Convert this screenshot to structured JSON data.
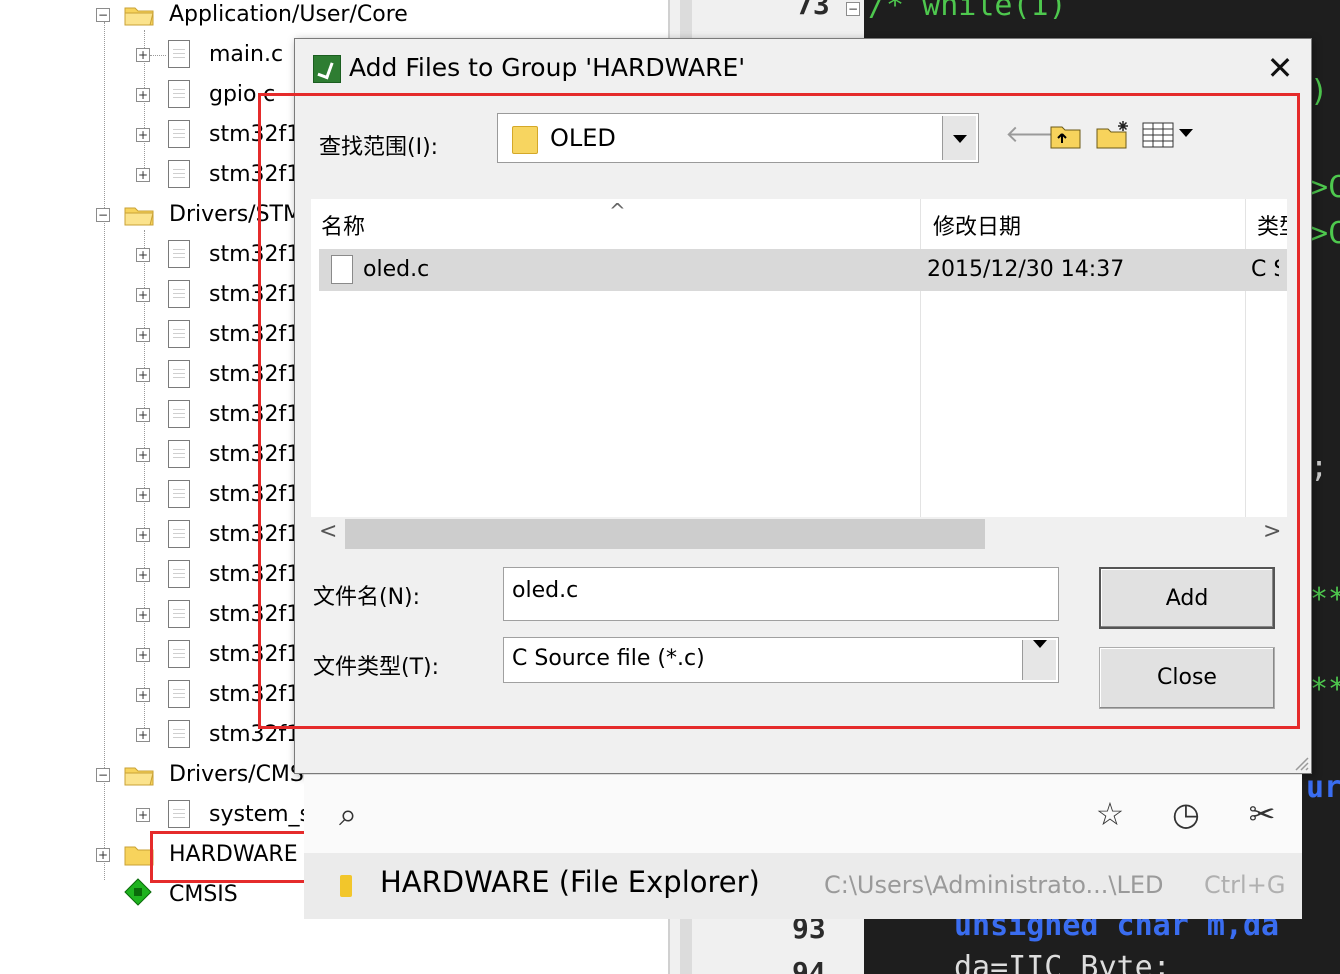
{
  "project_tree": {
    "groups": [
      {
        "label": "Application/User/Core",
        "files": [
          "main.c",
          "gpio.c",
          "stm32f1",
          "stm32f1"
        ]
      },
      {
        "label": "Drivers/STM",
        "files": [
          "stm32f1",
          "stm32f1",
          "stm32f1",
          "stm32f1",
          "stm32f1",
          "stm32f1",
          "stm32f1",
          "stm32f1",
          "stm32f1",
          "stm32f1",
          "stm32f1",
          "stm32f1",
          "stm32f1"
        ]
      },
      {
        "label": "Drivers/CMS",
        "files": [
          "system_s"
        ]
      },
      {
        "label": "HARDWARE",
        "files": []
      }
    ],
    "cmsis_label": "CMSIS"
  },
  "editor": {
    "line_numbers": [
      "73",
      "93",
      "94"
    ],
    "code_top": "/*   while(1)",
    "code_paren": ")",
    "code_gt1": ">C",
    "code_gt2": ">C",
    "code_semicolon": ";",
    "code_stars1": "**",
    "code_stars2": "**",
    "code_ur": "ur",
    "code_unsigned": "unsigned char m,da",
    "code_bottom": "da=IIC_Byte;"
  },
  "dialog": {
    "title": "Add Files to Group 'HARDWARE'",
    "close_glyph": "✕",
    "look_in_label": "查找范围(I):",
    "look_in_value": "OLED",
    "toolbar": {
      "back": "🡐",
      "up": "↥",
      "new_folder": "✱",
      "view": "▦▾"
    },
    "columns": {
      "name": "名称",
      "modified": "修改日期",
      "type": "类型"
    },
    "sort_caret": "^",
    "files": [
      {
        "name": "oled.c",
        "modified": "2015/12/30 14:37",
        "type": "C Source file"
      }
    ],
    "scroll_left": "<",
    "scroll_right": ">",
    "file_name_label": "文件名(N):",
    "file_name_value": "oled.c",
    "file_type_label": "文件类型(T):",
    "file_type_value": "C Source file (*.c)",
    "add_button": "Add",
    "close_button": "Close"
  },
  "search_panel": {
    "search_icon": "⌕",
    "star_icon": "☆",
    "history_icon": "◷",
    "tools_icon": "✂",
    "result_title": "HARDWARE (File Explorer)",
    "result_path": "C:\\Users\\Administrato...\\LED",
    "result_shortcut": "Ctrl+G"
  },
  "colors": {
    "highlight_box": "#e52b2b",
    "editor_bg": "#1e1e1e",
    "code_green": "#4ec84e",
    "code_blue": "#3a6df0"
  }
}
